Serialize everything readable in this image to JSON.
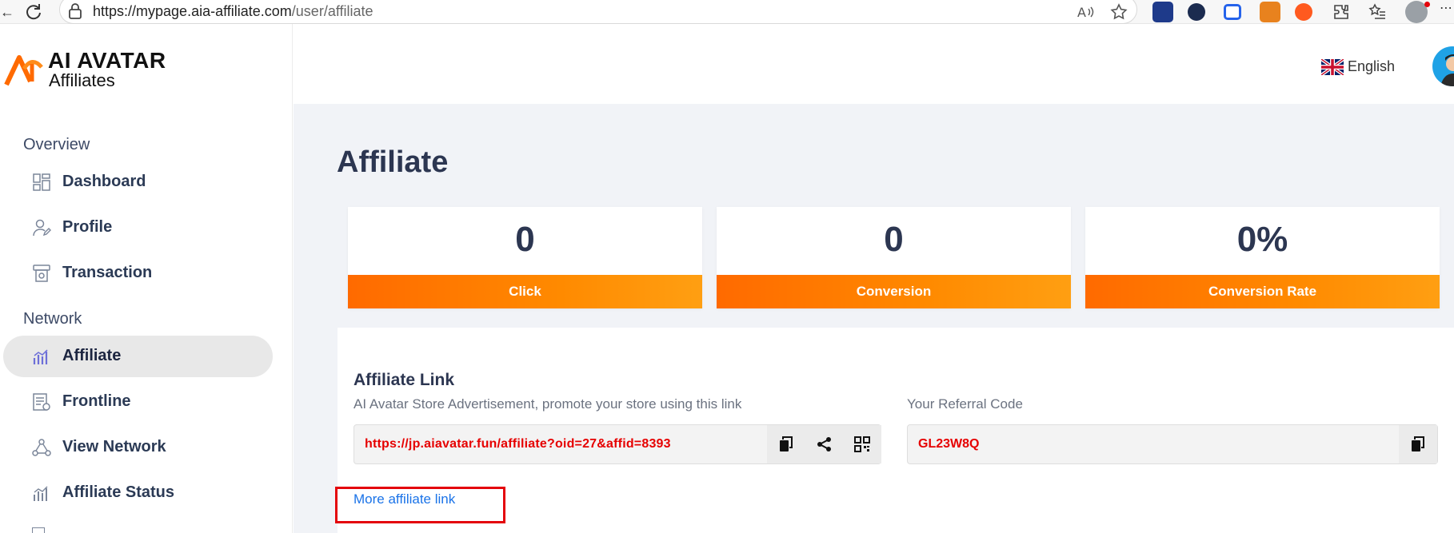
{
  "browser": {
    "url_domain": "https://mypage.aia-affiliate.com",
    "url_path": "/user/affiliate"
  },
  "sidebar": {
    "logo_line1": "AI AVATAR",
    "logo_line2": "Affiliates",
    "sections": [
      {
        "title": "Overview",
        "items": [
          {
            "label": "Dashboard",
            "icon": "dashboard-icon"
          },
          {
            "label": "Profile",
            "icon": "profile-icon"
          },
          {
            "label": "Transaction",
            "icon": "transaction-icon"
          }
        ]
      },
      {
        "title": "Network",
        "items": [
          {
            "label": "Affiliate",
            "icon": "affiliate-icon",
            "active": true
          },
          {
            "label": "Frontline",
            "icon": "frontline-icon"
          },
          {
            "label": "View Network",
            "icon": "network-icon"
          },
          {
            "label": "Affiliate Status",
            "icon": "affiliate-status-icon"
          }
        ]
      }
    ]
  },
  "header": {
    "language": "English"
  },
  "page": {
    "title": "Affiliate"
  },
  "stats": [
    {
      "value": "0",
      "label": "Click"
    },
    {
      "value": "0",
      "label": "Conversion"
    },
    {
      "value": "0%",
      "label": "Conversion Rate"
    }
  ],
  "affiliate_link": {
    "title": "Affiliate Link",
    "subtitle": "AI Avatar Store Advertisement, promote your store using this link",
    "link": "https://jp.aiavatar.fun/affiliate?oid=27&affid=8393",
    "referral_title": "Your Referral Code",
    "referral_code": "GL23W8Q",
    "more_link": "More affiliate link"
  },
  "colors": {
    "accent_orange": "#ff7a00",
    "link_red": "#e60000",
    "link_blue": "#1a73e8",
    "highlight_red": "#e4040b",
    "title_navy": "#2c3651"
  }
}
